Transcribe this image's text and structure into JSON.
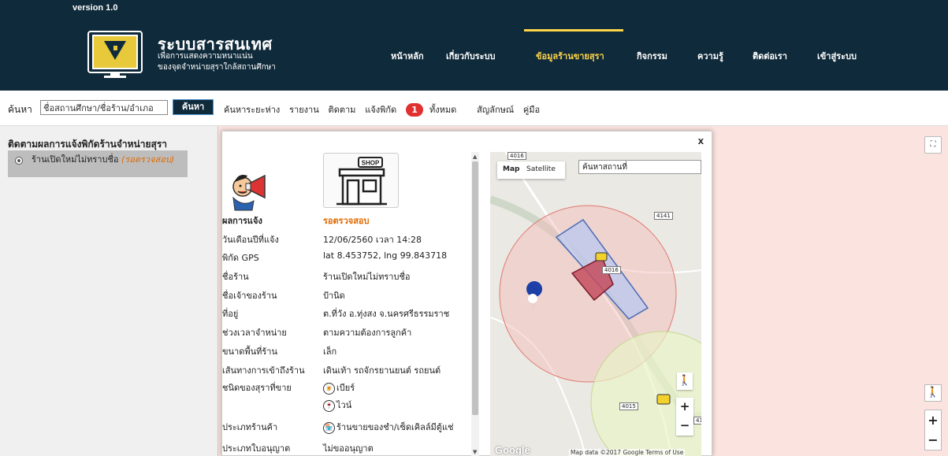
{
  "header": {
    "version": "version 1.0",
    "brand_title": "ระบบสารสนเทศ",
    "brand_sub1": "เพื่อการแสดงความหนาแน่น",
    "brand_sub2": "ของจุดจำหน่ายสุราใกล้สถานศึกษา",
    "nav": [
      {
        "label": "หน้าหลัก"
      },
      {
        "label": "เกี่ยวกับระบบ"
      },
      {
        "label": "ข้อมูลร้านขายสุรา"
      },
      {
        "label": "กิจกรรม"
      },
      {
        "label": "ความรู้"
      },
      {
        "label": "ติดต่อเรา"
      },
      {
        "label": "เข้าสู่ระบบ"
      }
    ],
    "active_nav": "ข้อมูลร้านขายสุรา"
  },
  "searchbar": {
    "label": "ค้นหา",
    "input_value": "ชื่อสถานศึกษา/ชื่อร้าน/อำเภอ",
    "button": "ค้นหา",
    "links": [
      "ค้นหาระยะห่าง",
      "รายงาน",
      "ติดตาม",
      "แจ้งพิกัด"
    ],
    "badge_count": "1",
    "all_label": "ทั้งหมด",
    "links2": [
      "สัญลักษณ์",
      "คู่มือ"
    ]
  },
  "leftpanel": {
    "title": "ติดตามผลการแจ้งพิกัดร้านจำหน่ายสุรา",
    "item_label": "ร้านเปิดใหม่ไม่ทราบชื่อ",
    "item_status": "(รอตรวจสอบ)"
  },
  "popup": {
    "close": "x",
    "shop_badge": "SHOP",
    "rows": [
      {
        "key": "ผลการแจ้ง",
        "value": "รอตรวจสอบ"
      },
      {
        "key": "วันเดือนปีที่แจ้ง",
        "value": "12/06/2560   เวลา 14:28"
      },
      {
        "key": "พิกัด GPS",
        "value": "lat 8.453752, lng 99.843718"
      },
      {
        "key": "ชื่อร้าน",
        "value": "ร้านเปิดใหม่ไม่ทราบชื่อ"
      },
      {
        "key": "ชื่อเจ้าของร้าน",
        "value": "ป้านิด"
      },
      {
        "key": "ที่อยู่",
        "value": "ต.ที่วัง อ.ทุ่งสง จ.นครศรีธรรมราช"
      },
      {
        "key": "ช่วงเวลาจำหน่าย",
        "value": "ตามความต้องการลูกค้า"
      },
      {
        "key": "ขนาดพื้นที่ร้าน",
        "value": "เล็ก"
      },
      {
        "key": "เส้นทางการเข้าถึงร้าน",
        "value": "เดินเท้า  รถจักรยานยนต์  รถยนต์"
      },
      {
        "key": "ชนิดของสุราที่ขาย",
        "value": ""
      },
      {
        "key": "ประเภทร้านค้า",
        "value": ""
      },
      {
        "key": "ประเภทใบอนุญาต",
        "value": "ไม่ขออนุญาต"
      }
    ],
    "liquor_types": [
      "เบียร์",
      "ไวน์"
    ],
    "shop_type": "ร้านขายของชำ/เซ็ดเคิลล์มีตู้แช่"
  },
  "map": {
    "btn_map": "Map",
    "btn_satellite": "Satellite",
    "search_placeholder": "ค้นหาสถานที่",
    "roads": [
      "4016",
      "4141",
      "4016",
      "4015",
      "41"
    ],
    "google": "Google",
    "attribution": "Map data ©2017 Google   Terms of Use",
    "zoom_in": "+",
    "zoom_out": "−"
  },
  "colors": {
    "header_bg": "#0f2a3a",
    "nav_active": "#ffd54a",
    "status_orange": "#e06a00",
    "badge_red": "#e03030"
  }
}
